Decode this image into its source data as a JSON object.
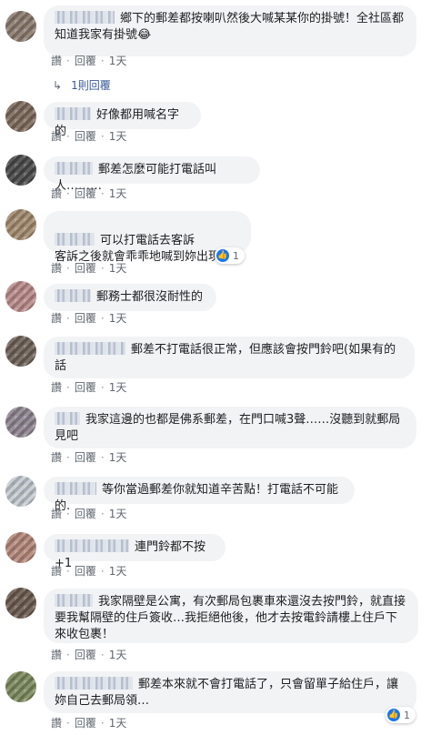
{
  "action_labels": {
    "like": "讚",
    "reply": "回覆",
    "separator": "·"
  },
  "comments": [
    {
      "text": "鄉下的郵差都按喇叭然後大喊某某你的掛號！全社區都知道我家有掛號😂",
      "time": "1天"
    },
    {
      "text": "好像都用喊名字的",
      "time": "1天"
    },
    {
      "text": "郵差怎麼可能打電話叫人………",
      "time": "1天"
    },
    {
      "text": "可以打電話去客訴\n客訴之後就會乖乖地喊到妳出現了",
      "time": "1天",
      "reactions": "1"
    },
    {
      "text": "郵務士都很沒耐性的",
      "time": "1天"
    },
    {
      "text": "郵差不打電話很正常，但應該會按門鈴吧(如果有的話",
      "time": "1天"
    },
    {
      "text": "我家這邊的也都是佛系郵差，在門口喊3聲……沒聽到就郵局見吧",
      "time": "1天"
    },
    {
      "text": "等你當過郵差你就知道辛苦點！打電話不可能的.",
      "time": "1天"
    },
    {
      "text": "連門鈴都不按+1",
      "time": "1天"
    },
    {
      "text": "我家隔壁是公寓，有次郵局包裹車來還沒去按門鈴，就直接要我幫隔壁的住戶簽收…我拒絕他後，他才去按電鈴請樓上住戶下來收包裹！",
      "time": "1天"
    },
    {
      "text": "郵差本來就不會打電話了，只會留單子給住戶，讓妳自己去郵局領…",
      "time": "1天",
      "reactions": "1"
    }
  ],
  "replies_link": "1則回覆",
  "colors": {
    "bubble": "#f2f3f5",
    "link": "#385898",
    "like_blue": "#1877f2",
    "meta_text": "#606770"
  }
}
